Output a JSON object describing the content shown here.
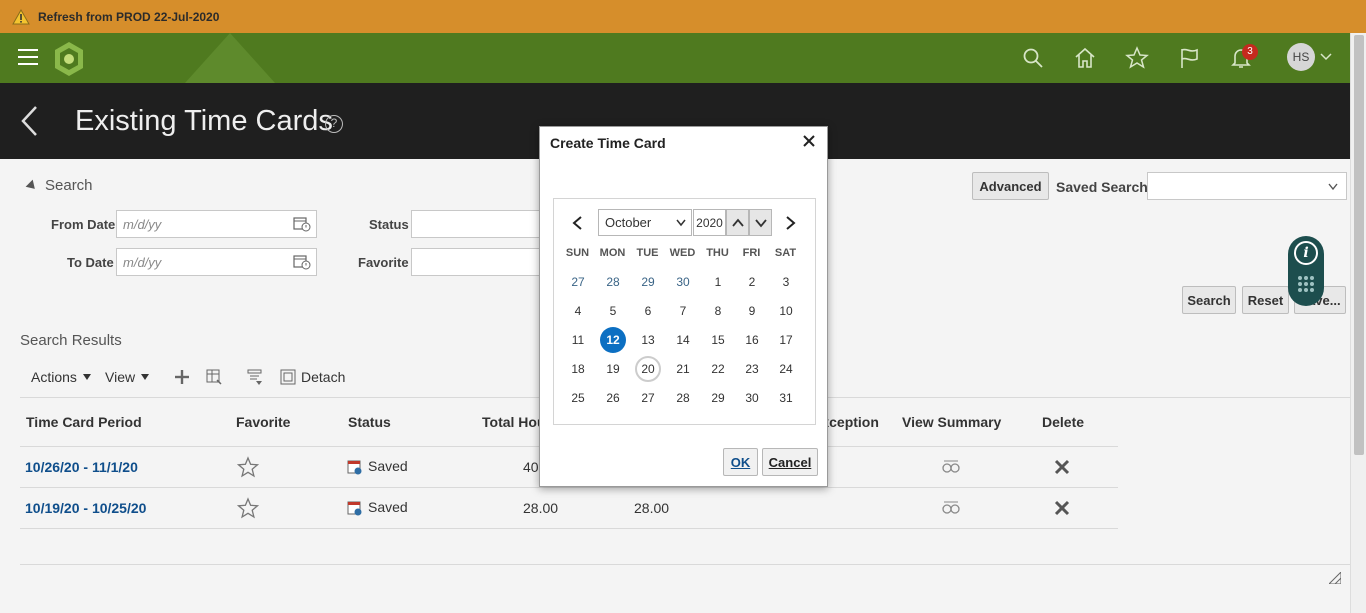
{
  "banner": {
    "text": "Refresh from PROD 22-Jul-2020"
  },
  "header": {
    "notification_count": "3",
    "user_initials": "HS"
  },
  "page": {
    "title": "Existing Time Cards",
    "help_glyph": "?"
  },
  "search": {
    "section_label": "Search",
    "from_date_label": "From Date",
    "from_date_placeholder": "m/d/yy",
    "to_date_label": "To Date",
    "to_date_placeholder": "m/d/yy",
    "status_label": "Status",
    "favorite_label": "Favorite",
    "advanced_label": "Advanced",
    "saved_search_label": "Saved Search",
    "search_button": "Search",
    "reset_button": "Reset",
    "save_button": "Save..."
  },
  "results": {
    "section_label": "Search Results",
    "actions_label": "Actions",
    "view_label": "View",
    "detach_label": "Detach",
    "columns": [
      "Time Card Period",
      "Favorite",
      "Status",
      "Total Hours",
      "",
      "Exception",
      "View Summary",
      "Delete"
    ],
    "rows": [
      {
        "period": "10/26/20 - 11/1/20",
        "status": "Saved",
        "total": "40",
        "other": ""
      },
      {
        "period": "10/19/20 - 10/25/20",
        "status": "Saved",
        "total": "28.00",
        "other": "28.00"
      }
    ]
  },
  "dialog": {
    "title": "Create Time Card",
    "month": "October",
    "year": "2020",
    "weekdays": [
      "SUN",
      "MON",
      "TUE",
      "WED",
      "THU",
      "FRI",
      "SAT"
    ],
    "days": [
      [
        "27",
        "28",
        "29",
        "30",
        "1",
        "2",
        "3"
      ],
      [
        "4",
        "5",
        "6",
        "7",
        "8",
        "9",
        "10"
      ],
      [
        "11",
        "12",
        "13",
        "14",
        "15",
        "16",
        "17"
      ],
      [
        "18",
        "19",
        "20",
        "21",
        "22",
        "23",
        "24"
      ],
      [
        "25",
        "26",
        "27",
        "28",
        "29",
        "30",
        "31"
      ]
    ],
    "selected_day": "12",
    "today_day": "20",
    "ok_label": "OK",
    "cancel_label": "Cancel"
  },
  "colors": {
    "banner": "#d68e2b",
    "header": "#4f7a1f",
    "title_bar": "#1f1f1f",
    "selected_day": "#0c6fc2",
    "link": "#0f4e8b"
  }
}
